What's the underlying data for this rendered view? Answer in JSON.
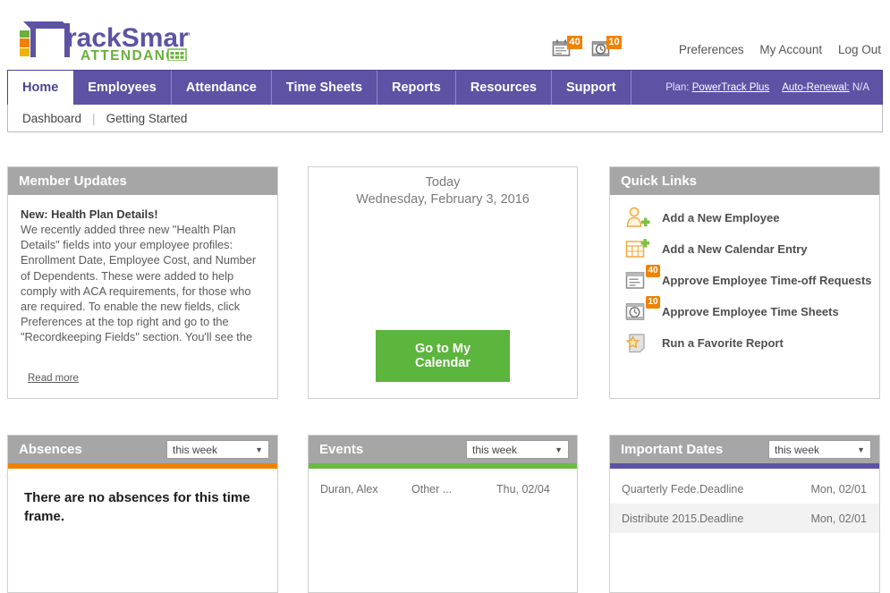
{
  "brand": {
    "name": "TrackSmart",
    "subtitle": "ATTENDANCE",
    "logo_icon": "tracksmart-logo-icon",
    "grid_icon": "attendance-grid-icon",
    "purple": "#5c53a5",
    "green": "#6aaf3f",
    "orange": "#ef8200"
  },
  "header": {
    "badges": [
      {
        "icon": "time-off-requests-icon",
        "count": "40"
      },
      {
        "icon": "time-sheets-clock-icon",
        "count": "10"
      }
    ],
    "links": [
      {
        "label": "Preferences"
      },
      {
        "label": "My Account"
      },
      {
        "label": "Log Out"
      }
    ]
  },
  "nav": {
    "tabs": [
      {
        "label": "Home",
        "active": true
      },
      {
        "label": "Employees",
        "active": false
      },
      {
        "label": "Attendance",
        "active": false
      },
      {
        "label": "Time Sheets",
        "active": false
      },
      {
        "label": "Reports",
        "active": false
      },
      {
        "label": "Resources",
        "active": false
      },
      {
        "label": "Support",
        "active": false
      }
    ],
    "plan_label": "Plan:",
    "plan_value": "PowerTrack Plus",
    "renewal_label": "Auto-Renewal:",
    "renewal_value": "N/A"
  },
  "subnav": {
    "items": [
      {
        "label": "Dashboard"
      },
      {
        "label": "Getting Started"
      }
    ],
    "divider": "|"
  },
  "member_updates": {
    "title": "Member Updates",
    "headline": "New: Health Plan Details!",
    "body": "We recently added three new \"Health Plan Details\" fields into your employee profiles: Enrollment Date, Employee Cost, and Number of Dependents. These were added to help comply with ACA requirements, for those who are required.  To enable the new fields, click Preferences at the top right and go to the \"Recordkeeping Fields\" section. You'll see the",
    "read_more": "Read more"
  },
  "today": {
    "label": "Today",
    "date": "Wednesday, February 3, 2016",
    "button": "Go to My Calendar"
  },
  "quick_links": {
    "title": "Quick Links",
    "items": [
      {
        "label": "Add a New Employee",
        "icon": "add-employee-icon",
        "badge": ""
      },
      {
        "label": "Add a New Calendar Entry",
        "icon": "add-calendar-entry-icon",
        "badge": ""
      },
      {
        "label": "Approve Employee Time-off Requests",
        "icon": "approve-time-off-icon",
        "badge": "40"
      },
      {
        "label": "Approve Employee Time Sheets",
        "icon": "approve-time-sheets-icon",
        "badge": "10"
      },
      {
        "label": "Run a Favorite Report",
        "icon": "favorite-report-icon",
        "badge": ""
      }
    ]
  },
  "absences": {
    "title": "Absences",
    "accent_color": "#ef8200",
    "period": "this week",
    "caret": "▼",
    "empty_message": "There are no absences for this time frame."
  },
  "events": {
    "title": "Events",
    "accent_color": "#6aba43",
    "period": "this week",
    "caret": "▼",
    "rows": [
      {
        "name": "Duran, Alex",
        "type": "Other ...",
        "date": "Thu, 02/04"
      }
    ]
  },
  "important_dates": {
    "title": "Important Dates",
    "accent_color": "#5c53a5",
    "period": "this week",
    "caret": "▼",
    "rows": [
      {
        "name": "Quarterly Fede...",
        "type": "Deadline",
        "date": "Mon, 02/01"
      },
      {
        "name": "Distribute 2015...",
        "type": "Deadline",
        "date": "Mon, 02/01"
      }
    ]
  }
}
